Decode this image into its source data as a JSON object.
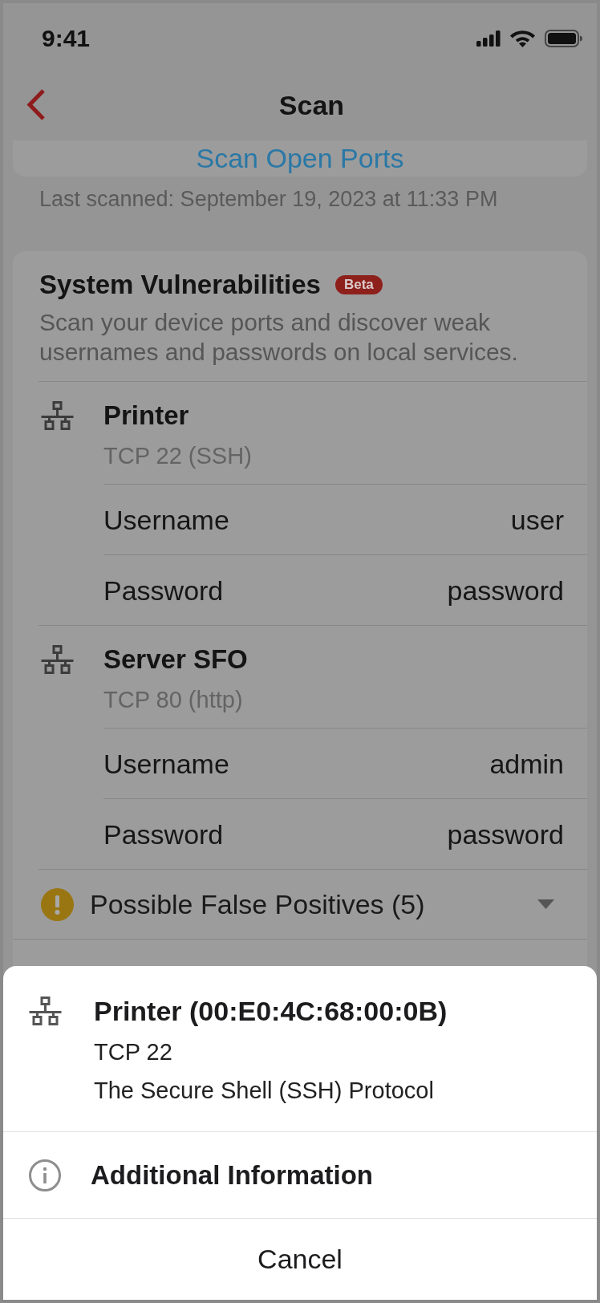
{
  "status_bar": {
    "time": "9:41"
  },
  "nav_bar": {
    "title": "Scan"
  },
  "scan_button": {
    "label": "Scan Open Ports"
  },
  "last_scanned": "Last scanned: September 19, 2023 at 11:33 PM",
  "vulnerabilities": {
    "title": "System Vulnerabilities",
    "badge": "Beta",
    "description": "Scan your device ports and discover weak usernames and passwords on local services.",
    "devices": [
      {
        "name": "Printer",
        "port": "TCP 22 (SSH)",
        "credentials": [
          {
            "label": "Username",
            "value": "user"
          },
          {
            "label": "Password",
            "value": "password"
          }
        ]
      },
      {
        "name": "Server SFO",
        "port": "TCP 80 (http)",
        "credentials": [
          {
            "label": "Username",
            "value": "admin"
          },
          {
            "label": "Password",
            "value": "password"
          }
        ]
      }
    ],
    "false_positives": {
      "label": "Possible False Positives (5)",
      "expanded": false
    }
  },
  "action_sheet": {
    "device": {
      "title": "Printer (00:E0:4C:68:00:0B)",
      "port": "TCP 22",
      "protocol": "The Secure Shell (SSH) Protocol"
    },
    "actions": [
      {
        "label": "Additional Information"
      }
    ],
    "cancel": "Cancel"
  }
}
